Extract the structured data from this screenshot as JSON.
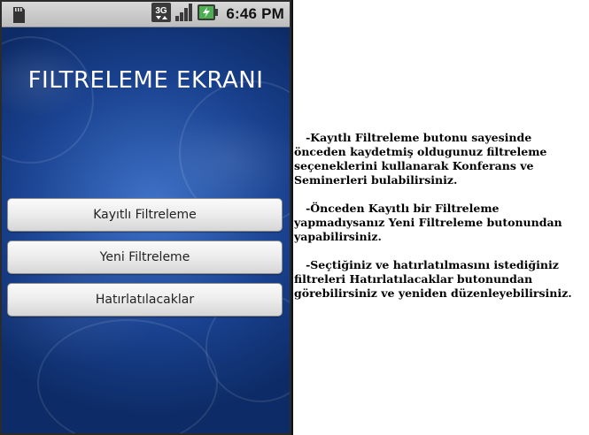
{
  "statusbar": {
    "network_label": "3G",
    "clock": "6:46 PM",
    "icons": [
      "sd-card-icon",
      "3g-icon",
      "signal-icon",
      "battery-icon"
    ]
  },
  "screen": {
    "title": "FILTRELEME EKRANI",
    "buttons": [
      {
        "label": "Kayıtlı Filtreleme"
      },
      {
        "label": "Yeni Filtreleme"
      },
      {
        "label": "Hatırlatılacaklar"
      }
    ]
  },
  "info": {
    "paragraphs": [
      "   -Kayıtlı Filtreleme butonu sayesinde önceden kaydetmiş oldugunuz filtreleme seçeneklerini kullanarak Konferans ve Seminerleri bulabilirsiniz.",
      "   -Önceden Kayıtlı bir Filtreleme yapmadıysanız Yeni Filtreleme butonundan yapabilirsiniz.",
      "   -Seçtiğiniz ve hatırlatılmasını istediğiniz filtreleri Hatırlatılacaklar butonundan görebilirsiniz ve yeniden düzenleyebilirsiniz."
    ]
  },
  "colors": {
    "background_blue": "#19418e",
    "statusbar_gray": "#cfcfcf",
    "title_text": "#ffffff"
  }
}
